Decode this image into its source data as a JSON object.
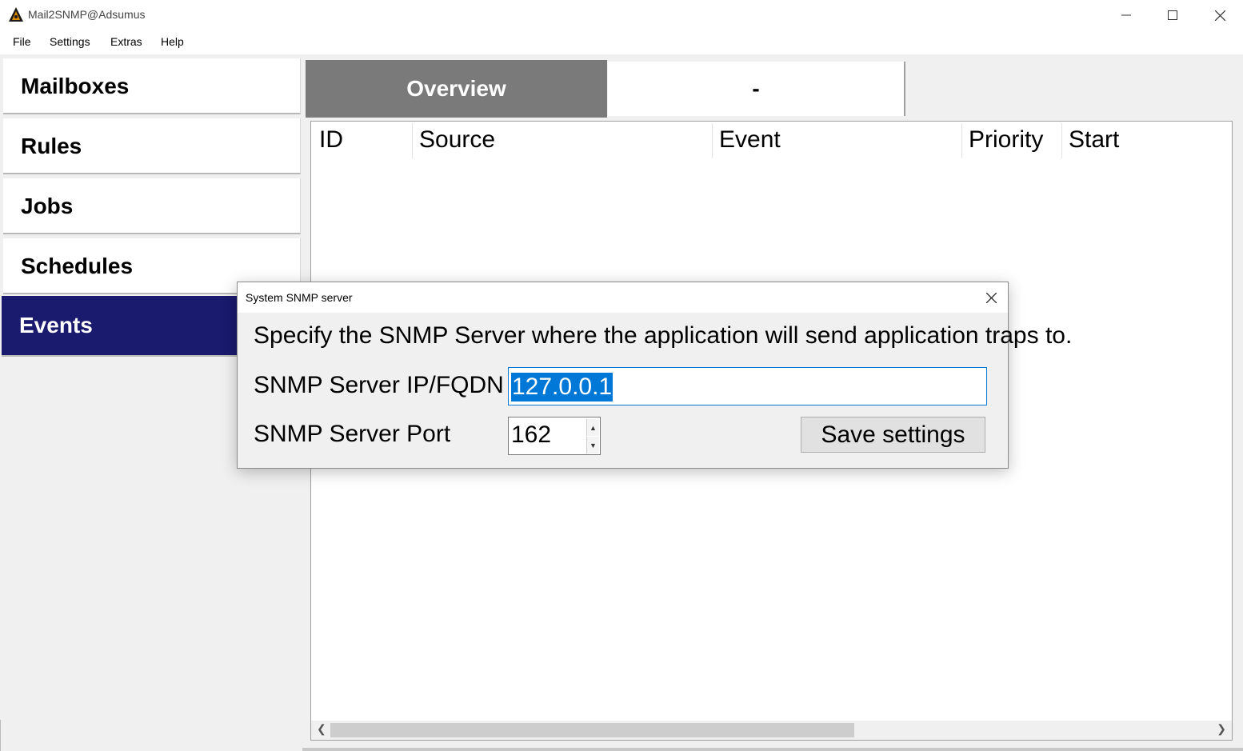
{
  "window": {
    "title": "Mail2SNMP@Adsumus"
  },
  "menu": {
    "items": [
      "File",
      "Settings",
      "Extras",
      "Help"
    ]
  },
  "sidebar": {
    "items": [
      {
        "label": "Mailboxes"
      },
      {
        "label": "Rules"
      },
      {
        "label": "Jobs"
      },
      {
        "label": "Schedules"
      },
      {
        "label": "Events",
        "active": true
      }
    ]
  },
  "tabs": [
    {
      "label": "Overview",
      "active": true
    },
    {
      "label": "-"
    }
  ],
  "table": {
    "columns": [
      "ID",
      "Source",
      "Event",
      "Priority",
      "Start"
    ],
    "rows": []
  },
  "dialog": {
    "title": "System SNMP server",
    "description": "Specify the SNMP Server where the application will send application traps to.",
    "ip_label": "SNMP Server IP/FQDN",
    "ip_value": "127.0.0.1",
    "port_label": "SNMP Server Port",
    "port_value": "162",
    "save_label": "Save settings"
  },
  "colors": {
    "sidebar_active": "#1a1a6e",
    "tab_active": "#7a7a7a",
    "selection": "#0078d7"
  }
}
